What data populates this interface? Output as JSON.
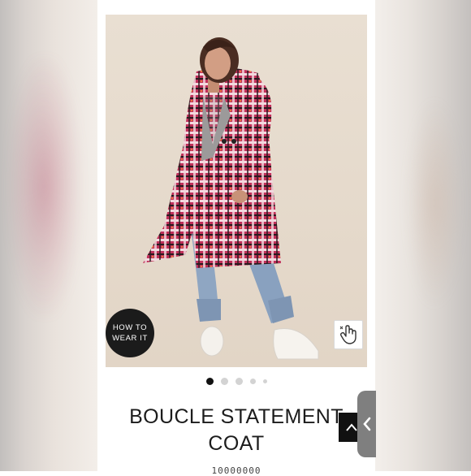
{
  "product": {
    "image_alt": "Model wearing pink plaid boucle coat",
    "how_to_wear": {
      "line1": "HOW TO",
      "line2": "WEAR IT"
    },
    "touch_icon": "hand-pointer-icon",
    "carousel": {
      "total": 5,
      "active_index": 0
    },
    "title_line1": "BOUCLE STATEMENT",
    "title_line2": "COAT",
    "sku": "10000000"
  },
  "controls": {
    "back_to_top_icon": "chevron-up-icon",
    "side_tab_icon": "chevron-left-icon"
  },
  "colors": {
    "accent_pink": "#d21f6f",
    "plaid_red": "#b02a4a",
    "dark": "#111111",
    "background": "#e7dccf"
  }
}
